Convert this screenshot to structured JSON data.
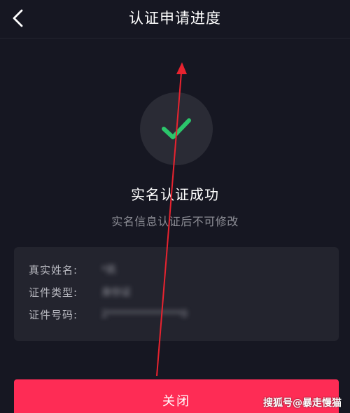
{
  "header": {
    "back_icon": "chevron-left-icon",
    "title": "认证申请进度"
  },
  "status": {
    "icon": "checkmark-icon",
    "accent_color": "#2bc66b",
    "title": "实名认证成功",
    "subtitle": "实名信息认证后不可修改"
  },
  "info": {
    "rows": [
      {
        "label": "真实姓名:",
        "value": "*凯"
      },
      {
        "label": "证件类型:",
        "value": "身份证"
      },
      {
        "label": "证件号码:",
        "value": "2***************0"
      }
    ]
  },
  "actions": {
    "close_label": "关闭",
    "close_color": "#fe2c55"
  },
  "watermark": "搜狐号@暴走慢猫",
  "annotation": {
    "arrow_color": "#e8232f"
  }
}
